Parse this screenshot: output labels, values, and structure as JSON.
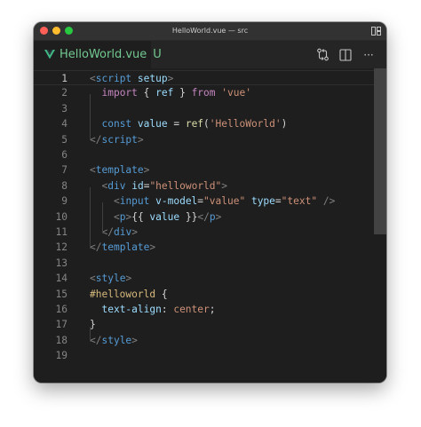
{
  "window": {
    "title": "HelloWorld.vue — src"
  },
  "tab": {
    "filename": "HelloWorld.vue",
    "status": "U",
    "icon": "vue-icon",
    "status_color": "#73c991"
  },
  "actions": [
    {
      "icon": "git-compare-icon"
    },
    {
      "icon": "split-editor-icon"
    },
    {
      "icon": "more-actions-icon",
      "label": "···"
    }
  ],
  "editor": {
    "current_line": 1,
    "lines": [
      {
        "n": "1",
        "tokens": [
          [
            "c-tag",
            "<"
          ],
          [
            "c-tagname",
            "script"
          ],
          [
            "c-plain",
            " "
          ],
          [
            "c-attr",
            "setup"
          ],
          [
            "c-tag",
            ">"
          ]
        ]
      },
      {
        "n": "2",
        "tokens": [
          [
            "c-plain",
            "  "
          ],
          [
            "c-kw",
            "import"
          ],
          [
            "c-plain",
            " { "
          ],
          [
            "c-var",
            "ref"
          ],
          [
            "c-plain",
            " } "
          ],
          [
            "c-kw",
            "from"
          ],
          [
            "c-plain",
            " "
          ],
          [
            "c-str",
            "'vue'"
          ]
        ]
      },
      {
        "n": "3",
        "tokens": []
      },
      {
        "n": "4",
        "tokens": [
          [
            "c-plain",
            "  "
          ],
          [
            "c-decl",
            "const"
          ],
          [
            "c-plain",
            " "
          ],
          [
            "c-var",
            "value"
          ],
          [
            "c-plain",
            " = "
          ],
          [
            "c-fn",
            "ref"
          ],
          [
            "c-plain",
            "("
          ],
          [
            "c-str",
            "'HelloWorld'"
          ],
          [
            "c-plain",
            ")"
          ]
        ]
      },
      {
        "n": "5",
        "tokens": [
          [
            "c-tag",
            "</"
          ],
          [
            "c-tagname",
            "script"
          ],
          [
            "c-tag",
            ">"
          ]
        ]
      },
      {
        "n": "6",
        "tokens": []
      },
      {
        "n": "7",
        "tokens": [
          [
            "c-tag",
            "<"
          ],
          [
            "c-tagname",
            "template"
          ],
          [
            "c-tag",
            ">"
          ]
        ]
      },
      {
        "n": "8",
        "tokens": [
          [
            "c-plain",
            "  "
          ],
          [
            "c-tag",
            "<"
          ],
          [
            "c-tagname",
            "div"
          ],
          [
            "c-plain",
            " "
          ],
          [
            "c-attr",
            "id"
          ],
          [
            "c-plain",
            "="
          ],
          [
            "c-str",
            "\"helloworld\""
          ],
          [
            "c-tag",
            ">"
          ]
        ]
      },
      {
        "n": "9",
        "tokens": [
          [
            "c-plain",
            "    "
          ],
          [
            "c-tag",
            "<"
          ],
          [
            "c-tagname",
            "input"
          ],
          [
            "c-plain",
            " "
          ],
          [
            "c-attr",
            "v-model"
          ],
          [
            "c-plain",
            "="
          ],
          [
            "c-str",
            "\"value\""
          ],
          [
            "c-plain",
            " "
          ],
          [
            "c-attr",
            "type"
          ],
          [
            "c-plain",
            "="
          ],
          [
            "c-str",
            "\"text\""
          ],
          [
            "c-plain",
            " "
          ],
          [
            "c-tag",
            "/>"
          ]
        ]
      },
      {
        "n": "10",
        "tokens": [
          [
            "c-plain",
            "    "
          ],
          [
            "c-tag",
            "<"
          ],
          [
            "c-tagname",
            "p"
          ],
          [
            "c-tag",
            ">"
          ],
          [
            "c-plain",
            "{{ "
          ],
          [
            "c-var",
            "value"
          ],
          [
            "c-plain",
            " }}"
          ],
          [
            "c-tag",
            "</"
          ],
          [
            "c-tagname",
            "p"
          ],
          [
            "c-tag",
            ">"
          ]
        ]
      },
      {
        "n": "11",
        "tokens": [
          [
            "c-plain",
            "  "
          ],
          [
            "c-tag",
            "</"
          ],
          [
            "c-tagname",
            "div"
          ],
          [
            "c-tag",
            ">"
          ]
        ]
      },
      {
        "n": "12",
        "tokens": [
          [
            "c-tag",
            "</"
          ],
          [
            "c-tagname",
            "template"
          ],
          [
            "c-tag",
            ">"
          ]
        ]
      },
      {
        "n": "13",
        "tokens": []
      },
      {
        "n": "14",
        "tokens": [
          [
            "c-tag",
            "<"
          ],
          [
            "c-tagname",
            "style"
          ],
          [
            "c-tag",
            ">"
          ]
        ]
      },
      {
        "n": "15",
        "tokens": [
          [
            "c-sel",
            "#helloworld"
          ],
          [
            "c-plain",
            " {"
          ]
        ]
      },
      {
        "n": "16",
        "tokens": [
          [
            "c-plain",
            "  "
          ],
          [
            "c-prop",
            "text-align"
          ],
          [
            "c-plain",
            ": "
          ],
          [
            "c-val",
            "center"
          ],
          [
            "c-plain",
            ";"
          ]
        ]
      },
      {
        "n": "17",
        "tokens": [
          [
            "c-plain",
            "}"
          ]
        ]
      },
      {
        "n": "18",
        "tokens": [
          [
            "c-tag",
            "</"
          ],
          [
            "c-tagname",
            "style"
          ],
          [
            "c-tag",
            ">"
          ]
        ]
      },
      {
        "n": "19",
        "tokens": []
      }
    ]
  },
  "colors": {
    "editor_bg": "#1e1e1e",
    "titlebar_bg": "#323233",
    "tabbar_bg": "#252526",
    "tag_name": "#569cd6",
    "string": "#ce9178",
    "keyword": "#c586c0"
  }
}
